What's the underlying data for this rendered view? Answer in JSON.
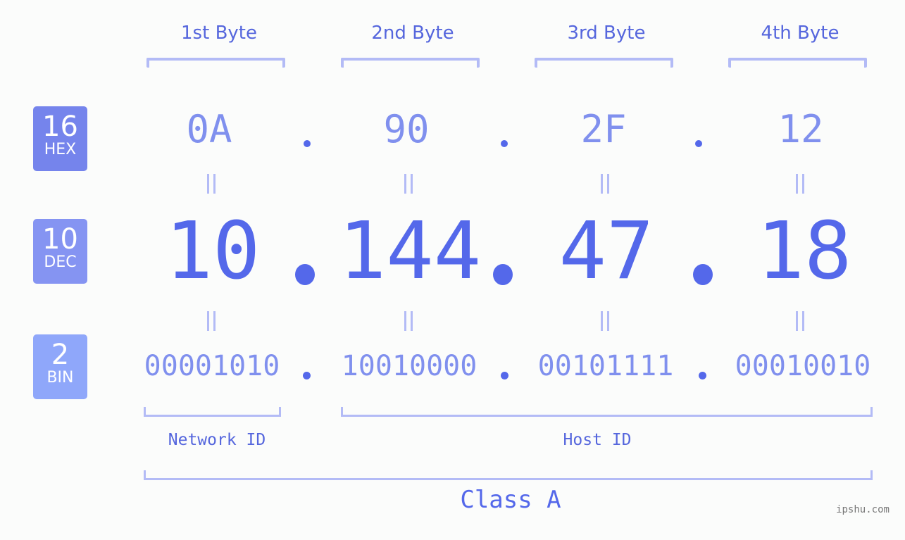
{
  "colors": {
    "accent": "#5468ea",
    "hex_box": "#7584ec",
    "dec_box": "#8594f2",
    "bin_box": "#8fa7fa",
    "light_value": "#8090ee",
    "bracket": "#b3bbf6",
    "background": "#fbfcfb"
  },
  "bytes": [
    {
      "label": "1st Byte",
      "hex": "0A",
      "dec": "10",
      "bin": "00001010"
    },
    {
      "label": "2nd Byte",
      "hex": "90",
      "dec": "144",
      "bin": "10010000"
    },
    {
      "label": "3rd Byte",
      "hex": "2F",
      "dec": "47",
      "bin": "00101111"
    },
    {
      "label": "4th Byte",
      "hex": "12",
      "dec": "18",
      "bin": "00010010"
    }
  ],
  "radix": [
    {
      "base": "16",
      "name": "HEX"
    },
    {
      "base": "10",
      "name": "DEC"
    },
    {
      "base": "2",
      "name": "BIN"
    }
  ],
  "separator": ".",
  "equals_icon": "equals-icon",
  "network_id_label": "Network ID",
  "host_id_label": "Host ID",
  "class_label": "Class A",
  "watermark": "ipshu.com"
}
